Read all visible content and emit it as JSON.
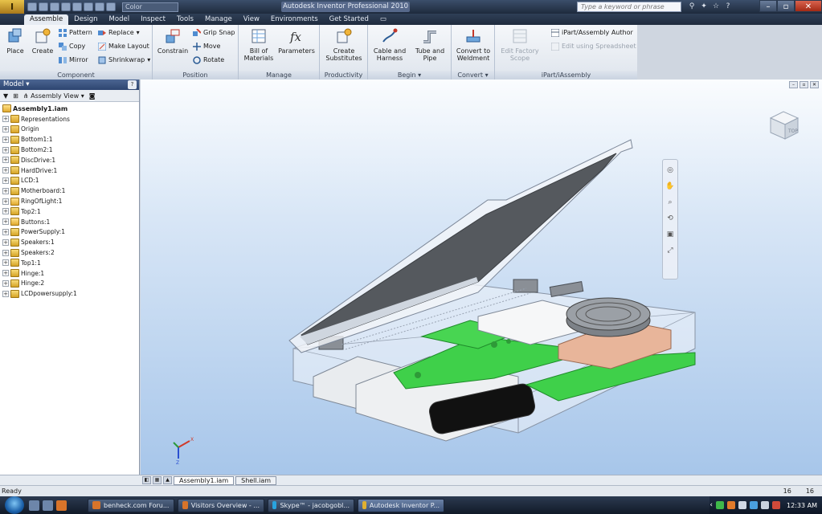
{
  "titlebar": {
    "app_button": "I",
    "color_selector": "Color",
    "window_title": "Autodesk Inventor Professional 2010",
    "search_placeholder": "Type a keyword or phrase",
    "window_controls": [
      "–",
      "▫",
      "✕"
    ]
  },
  "tabs": [
    {
      "label": "Assemble",
      "active": true
    },
    {
      "label": "Design",
      "active": false
    },
    {
      "label": "Model",
      "active": false
    },
    {
      "label": "Inspect",
      "active": false
    },
    {
      "label": "Tools",
      "active": false
    },
    {
      "label": "Manage",
      "active": false
    },
    {
      "label": "View",
      "active": false
    },
    {
      "label": "Environments",
      "active": false
    },
    {
      "label": "Get Started",
      "active": false
    }
  ],
  "ribbon": {
    "component": {
      "label": "Component",
      "place": "Place",
      "create": "Create",
      "pattern": "Pattern",
      "copy": "Copy",
      "mirror": "Mirror",
      "replace": "Replace",
      "make_layout": "Make Layout",
      "shrinkwrap": "Shrinkwrap"
    },
    "position": {
      "label": "Position",
      "constrain": "Constrain",
      "grip_snap": "Grip Snap",
      "move": "Move",
      "rotate": "Rotate"
    },
    "manage": {
      "label": "Manage",
      "bom_line1": "Bill of",
      "bom_line2": "Materials",
      "parameters": "Parameters"
    },
    "productivity": {
      "label": "Productivity",
      "line1": "Create",
      "line2": "Substitutes"
    },
    "begin": {
      "label": "Begin ▾",
      "cable_line1": "Cable and",
      "cable_line2": "Harness",
      "tube_line1": "Tube and",
      "tube_line2": "Pipe"
    },
    "convert": {
      "label": "Convert ▾",
      "line1": "Convert to",
      "line2": "Weldment"
    },
    "ipart": {
      "label": "iPart/iAssembly",
      "edit_factory_line1": "Edit Factory",
      "edit_factory_line2": "Scope",
      "author": "iPart/Assembly Author",
      "edit_spreadsheet": "Edit using Spreadsheet"
    }
  },
  "model_browser": {
    "title": "Model ▾",
    "view_label": "Assembly View",
    "root": "Assembly1.iam",
    "items": [
      {
        "label": "Representations",
        "icon": "folder"
      },
      {
        "label": "Origin",
        "icon": "folder"
      },
      {
        "label": "Bottom1:1",
        "icon": "part"
      },
      {
        "label": "Bottom2:1",
        "icon": "part"
      },
      {
        "label": "DiscDrive:1",
        "icon": "part"
      },
      {
        "label": "HardDrive:1",
        "icon": "part"
      },
      {
        "label": "LCD:1",
        "icon": "part"
      },
      {
        "label": "Motherboard:1",
        "icon": "part"
      },
      {
        "label": "RingOfLight:1",
        "icon": "asm"
      },
      {
        "label": "Top2:1",
        "icon": "part"
      },
      {
        "label": "Buttons:1",
        "icon": "asm"
      },
      {
        "label": "PowerSupply:1",
        "icon": "part"
      },
      {
        "label": "Speakers:1",
        "icon": "part"
      },
      {
        "label": "Speakers:2",
        "icon": "part"
      },
      {
        "label": "Top1:1",
        "icon": "part"
      },
      {
        "label": "Hinge:1",
        "icon": "part"
      },
      {
        "label": "Hinge:2",
        "icon": "part"
      },
      {
        "label": "LCDpowersupply:1",
        "icon": "part"
      }
    ]
  },
  "viewcube": {
    "label": "TOP"
  },
  "triad": {
    "x": "X",
    "z": "Z"
  },
  "doc_tabs": [
    "Assembly1.iam",
    "Shell.iam"
  ],
  "status": {
    "text": "Ready",
    "num1": "16",
    "num2": "16"
  },
  "taskbar": {
    "items": [
      {
        "label": "benheck.com Foru...",
        "active": false
      },
      {
        "label": "Visitors Overview - ...",
        "active": false
      },
      {
        "label": "Skype™ - jacobgobl...",
        "active": false
      },
      {
        "label": "Autodesk Inventor P...",
        "active": true
      }
    ],
    "clock": "12:33 AM"
  },
  "colors": {
    "pcb_green": "#3fd04a",
    "viewport_top": "#fafcfe",
    "viewport_bottom": "#a7c6ea",
    "title_dark": "#1e2a3c"
  }
}
